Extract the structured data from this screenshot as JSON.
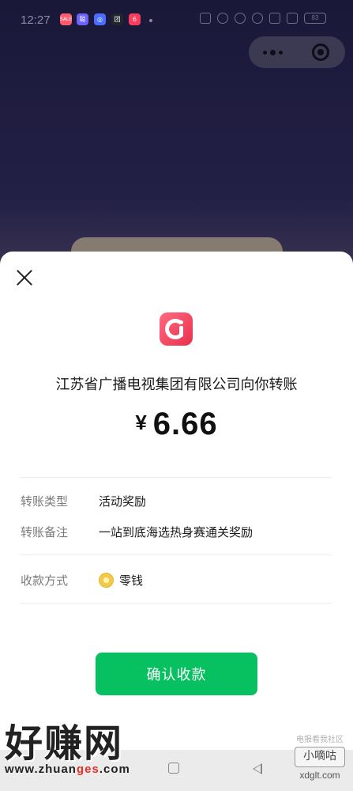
{
  "status_bar": {
    "time": "12:27",
    "apps": [
      {
        "name": "app-icon-1",
        "glyph": "SALE",
        "color": "#ff5a6e"
      },
      {
        "name": "app-icon-2",
        "glyph": "聪",
        "color": "#6c63ff"
      },
      {
        "name": "app-icon-3",
        "glyph": "◎",
        "color": "#4a6cff"
      },
      {
        "name": "app-icon-4",
        "glyph": "团",
        "color": "#22252c"
      },
      {
        "name": "app-icon-5",
        "glyph": "6",
        "color": "#ff3b5c"
      }
    ],
    "battery": "83"
  },
  "sheet": {
    "title": "江苏省广播电视集团有限公司向你转账",
    "currency_symbol": "¥",
    "amount": "6.66",
    "details": [
      {
        "label": "转账类型",
        "value": "活动奖励"
      },
      {
        "label": "转账备注",
        "value": "一站到底海选热身赛通关奖励"
      }
    ],
    "payment": {
      "label": "收款方式",
      "value": "零钱"
    },
    "confirm_label": "确认收款"
  },
  "watermark": {
    "left_big": "好赚网",
    "left_url_prefix": "www.zhuan",
    "left_url_highlight": "ges",
    "left_url_suffix": ".com",
    "right_caption": "电报看我社区",
    "right_box": "小嘀咕",
    "right_domain": "xdglt.com"
  },
  "colors": {
    "accent_green": "#07c160",
    "logo_red": "#e8304e"
  }
}
